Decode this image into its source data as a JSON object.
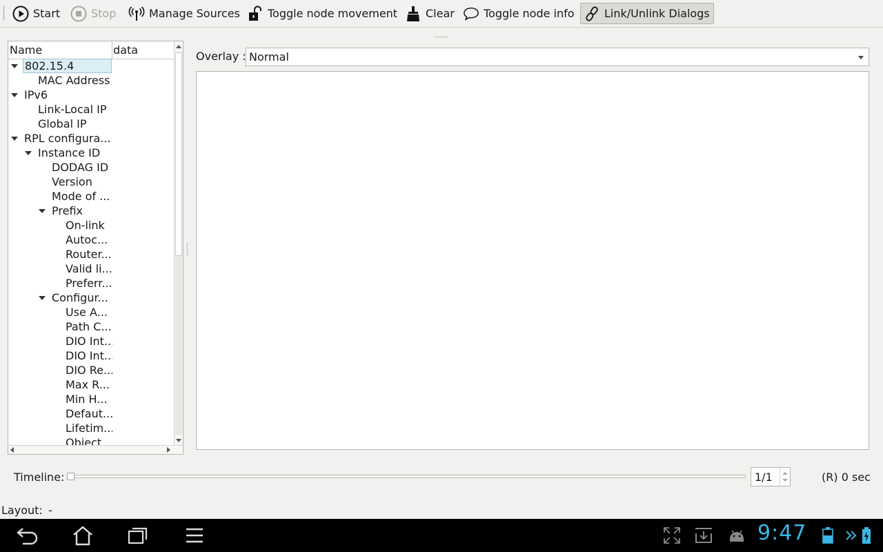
{
  "toolbar": {
    "start": "Start",
    "stop": "Stop",
    "manage_sources": "Manage Sources",
    "toggle_movement": "Toggle node movement",
    "clear": "Clear",
    "toggle_info": "Toggle node info",
    "link_unlink": "Link/Unlink Dialogs"
  },
  "tree": {
    "col_name": "Name",
    "col_data": "data",
    "rows": [
      "802.15.4",
      "MAC Address",
      "IPv6",
      "Link-Local IP",
      "Global IP",
      "RPL configura...",
      "Instance ID",
      "DODAG ID",
      "Version",
      "Mode of ...",
      "Prefix",
      "On-link",
      "Autoc...",
      "Router...",
      "Valid li...",
      "Preferr...",
      "Configur...",
      "Use A...",
      "Path C...",
      "DIO Int...",
      "DIO Int...",
      "DIO Re...",
      "Max R...",
      "Min H...",
      "Defaut...",
      "Lifetim...",
      "Object..."
    ]
  },
  "overlay": {
    "label": "Overlay :",
    "value": "Normal"
  },
  "timeline": {
    "label": "Timeline:",
    "position": 0.0,
    "spin_value": "1/1",
    "time": "(R) 0 sec"
  },
  "layout": {
    "label": "Layout:",
    "value": "-"
  },
  "statusbar": {
    "clock": "9:47"
  },
  "colors": {
    "clock": "#3ab7e6",
    "selection": "#dbeef5"
  }
}
